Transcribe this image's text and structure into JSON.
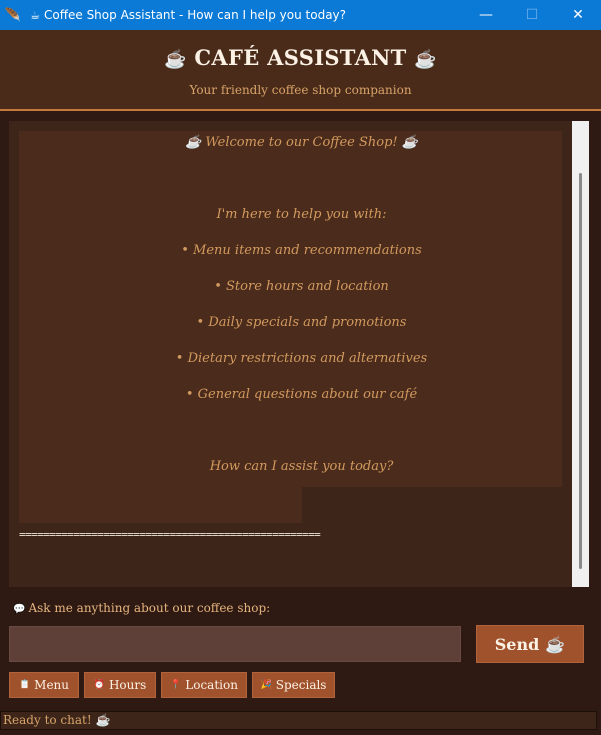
{
  "window": {
    "title": "Coffee Shop Assistant - How can I help you today?",
    "app_icon": "🪶",
    "cup_icon": "☕",
    "minimize": "—",
    "maximize": "☐",
    "close": "✕"
  },
  "header": {
    "icon_left": "☕",
    "title": "CAFÉ ASSISTANT",
    "icon_right": "☕",
    "subtitle": "Your friendly coffee shop companion"
  },
  "chat": {
    "lines": [
      "☕ Welcome to our Coffee Shop! ☕",
      "I'm here to help you with:",
      "• Menu items and recommendations",
      "• Store hours and location",
      "• Daily specials and promotions",
      "• Dietary restrictions and alternatives",
      "• General questions about our café",
      "How can I assist you today?"
    ],
    "separator": "=================================================="
  },
  "input": {
    "label_icon": "💬",
    "label": "Ask me anything about our coffee shop:",
    "value": "",
    "send_label": "Send",
    "send_icon": "☕"
  },
  "quick_buttons": [
    {
      "icon": "📋",
      "label": "Menu"
    },
    {
      "icon": "⏰",
      "label": "Hours"
    },
    {
      "icon": "📍",
      "label": "Location"
    },
    {
      "icon": "🎉",
      "label": "Specials"
    }
  ],
  "status": {
    "text": "Ready to chat! ☕"
  },
  "colors": {
    "titlebar": "#0b79d6",
    "background": "#2e1a12",
    "header": "#4a2a19",
    "accent": "#a0522d",
    "text_gold": "#d29a5f"
  }
}
